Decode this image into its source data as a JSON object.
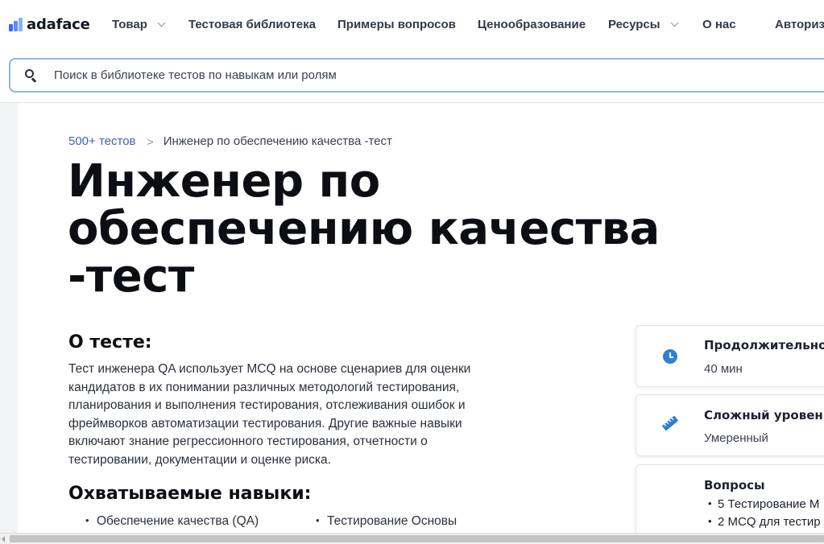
{
  "brand": {
    "name": "adaface",
    "logo_icon": "adaface-bars-logo"
  },
  "nav": {
    "items": [
      {
        "label": "Товар",
        "has_dropdown": true
      },
      {
        "label": "Тестовая библиотека",
        "has_dropdown": false
      },
      {
        "label": "Примеры вопросов",
        "has_dropdown": false
      },
      {
        "label": "Ценообразование",
        "has_dropdown": false
      },
      {
        "label": "Ресурсы",
        "has_dropdown": true
      },
      {
        "label": "О нас",
        "has_dropdown": false
      },
      {
        "label": "Авториз",
        "has_dropdown": false
      }
    ]
  },
  "search": {
    "placeholder": "Поиск в библиотеке тестов по навыкам или ролям",
    "value": "",
    "icon": "search-icon"
  },
  "breadcrumb": {
    "parent": "500+ тестов",
    "separator": ">",
    "current": "Инженер по обеспечению качества -тест"
  },
  "page": {
    "title_lines": [
      "Инженер по",
      "обеспечению качества",
      "-тест"
    ]
  },
  "about": {
    "heading": "О тесте:",
    "lines": [
      "Тест инженера QA использует MCQ на основе сценариев для оценки",
      "кандидатов в их понимании различных методологий тестирования,",
      "планирования и выполнения тестирования, отслеживания ошибок и",
      "фреймворков автоматизации тестирования. Другие важные навыки",
      "включают знание регрессионного тестирования, отчетности о",
      "тестировании, документации и оценке риска."
    ]
  },
  "skills": {
    "heading": "Охватываемые навыки:",
    "items": [
      "Обеспечение качества (QA)",
      "Тестирование Основы"
    ]
  },
  "info_cards": {
    "duration": {
      "title": "Продолжительно",
      "value": "40 мин",
      "icon": "clock-icon"
    },
    "difficulty": {
      "title": "Сложный уровен",
      "value": "Умеренный",
      "icon": "ruler-icon"
    },
    "questions": {
      "title": "Вопросы",
      "items": [
        "5 Тестирование М",
        "2 MCQ для тестир"
      ]
    }
  },
  "colors": {
    "accent": "#2f80d6",
    "link": "#3f63b5",
    "search_border": "#8fb4e8",
    "title": "#0c0e14"
  }
}
